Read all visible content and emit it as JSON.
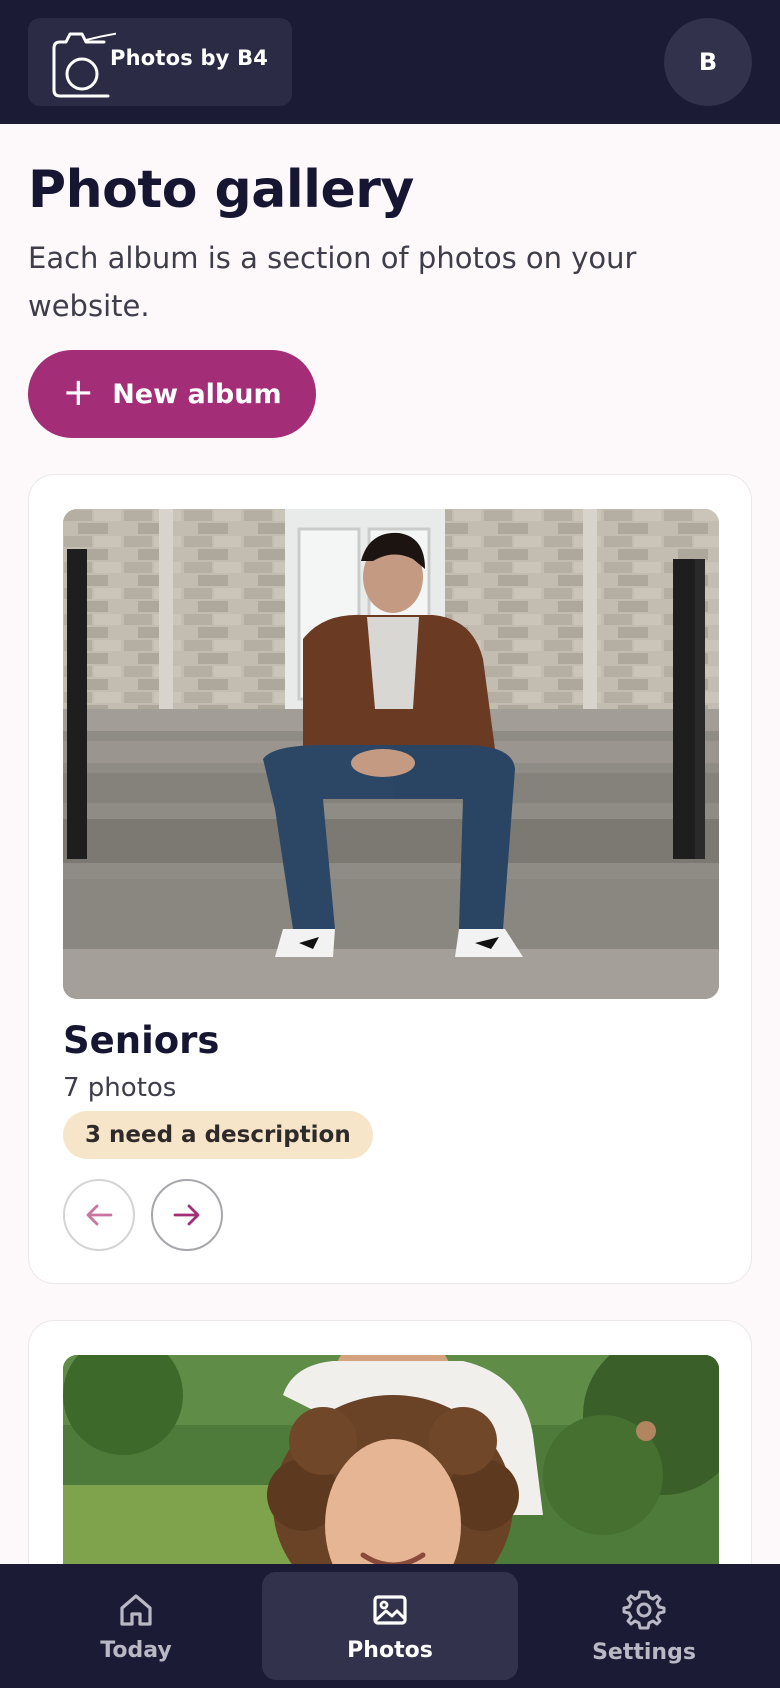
{
  "header": {
    "logo_text": "Photos by B4",
    "avatar_initial": "B"
  },
  "page": {
    "title": "Photo gallery",
    "subtitle": "Each album is a section of photos on your website.",
    "new_album_label": "New album"
  },
  "albums": [
    {
      "name": "Seniors",
      "count": "7 photos",
      "badge": "3 need a description"
    }
  ],
  "bottom_nav": {
    "items": [
      {
        "label": "Today",
        "icon": "home-icon"
      },
      {
        "label": "Photos",
        "icon": "image-icon",
        "active": true
      },
      {
        "label": "Settings",
        "icon": "gear-icon"
      }
    ]
  },
  "colors": {
    "brand_dark": "#1c1b36",
    "accent": "#a32d76",
    "badge_bg": "#f6e5c9"
  }
}
